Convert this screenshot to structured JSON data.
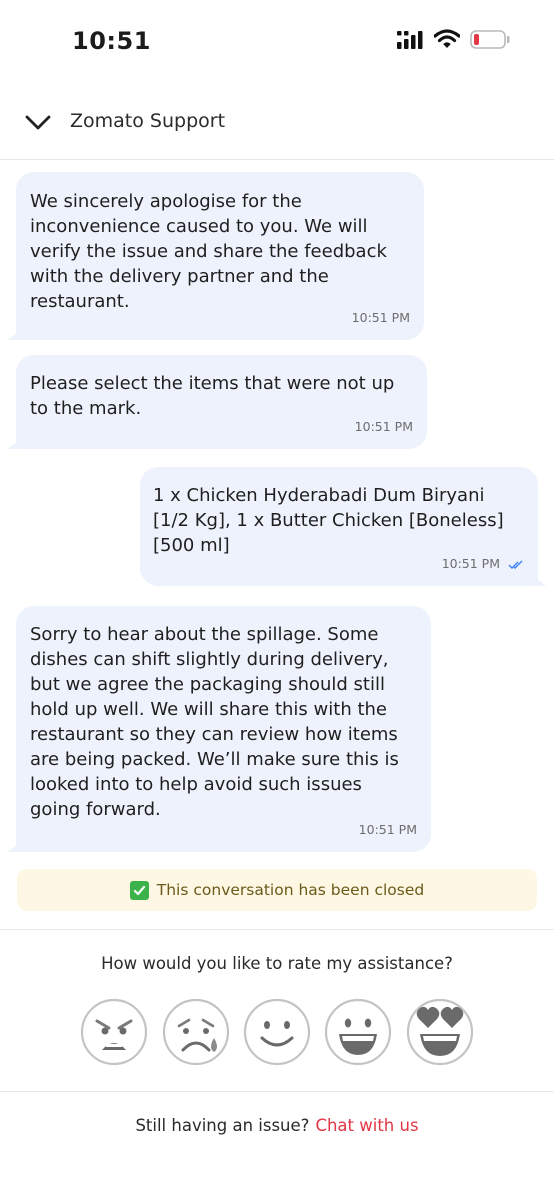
{
  "status_bar": {
    "time": "10:51"
  },
  "header": {
    "title": "Zomato Support",
    "back_icon": "chevron-down-icon"
  },
  "messages": [
    {
      "sender": "support",
      "text": "We sincerely apologise for the\ninconvenience caused to you. We will\nverify the issue and share the feedback\nwith the delivery partner and the\nrestaurant.",
      "time": "10:51 PM"
    },
    {
      "sender": "support",
      "text": "Please select the items that were not up\nto the mark.",
      "time": "10:51 PM"
    },
    {
      "sender": "user",
      "text": " 1 x Chicken Hyderabadi Dum Biryani\n[1/2 Kg], 1 x Butter Chicken [Boneless]\n[500 ml]",
      "time": "10:51 PM",
      "status_icon": "double-check-icon"
    },
    {
      "sender": "support",
      "text": "Sorry to hear about the spillage. Some\ndishes can shift slightly during delivery,\nbut we agree the packaging should still\nhold up well. We will share this with the\nrestaurant so they can review how items\nare being packed. We’ll make sure this is\nlooked into to help avoid such issues\ngoing forward.",
      "time": "10:51 PM"
    }
  ],
  "closed_banner": {
    "text": "This conversation has been closed",
    "icon": "check-box-icon"
  },
  "rating": {
    "question": "How would you like to rate my assistance?",
    "options": [
      "angry-face-icon",
      "crying-face-icon",
      "slightly-smiling-face-icon",
      "grinning-face-icon",
      "heart-eyes-face-icon"
    ]
  },
  "footer": {
    "text": "Still having an issue?",
    "link": "Chat with us"
  },
  "colors": {
    "bubble": "#eef2fd",
    "link": "#e23744",
    "banner": "#fdf7e3",
    "check": "#3cb34a",
    "read_tick": "#3b82f6"
  }
}
